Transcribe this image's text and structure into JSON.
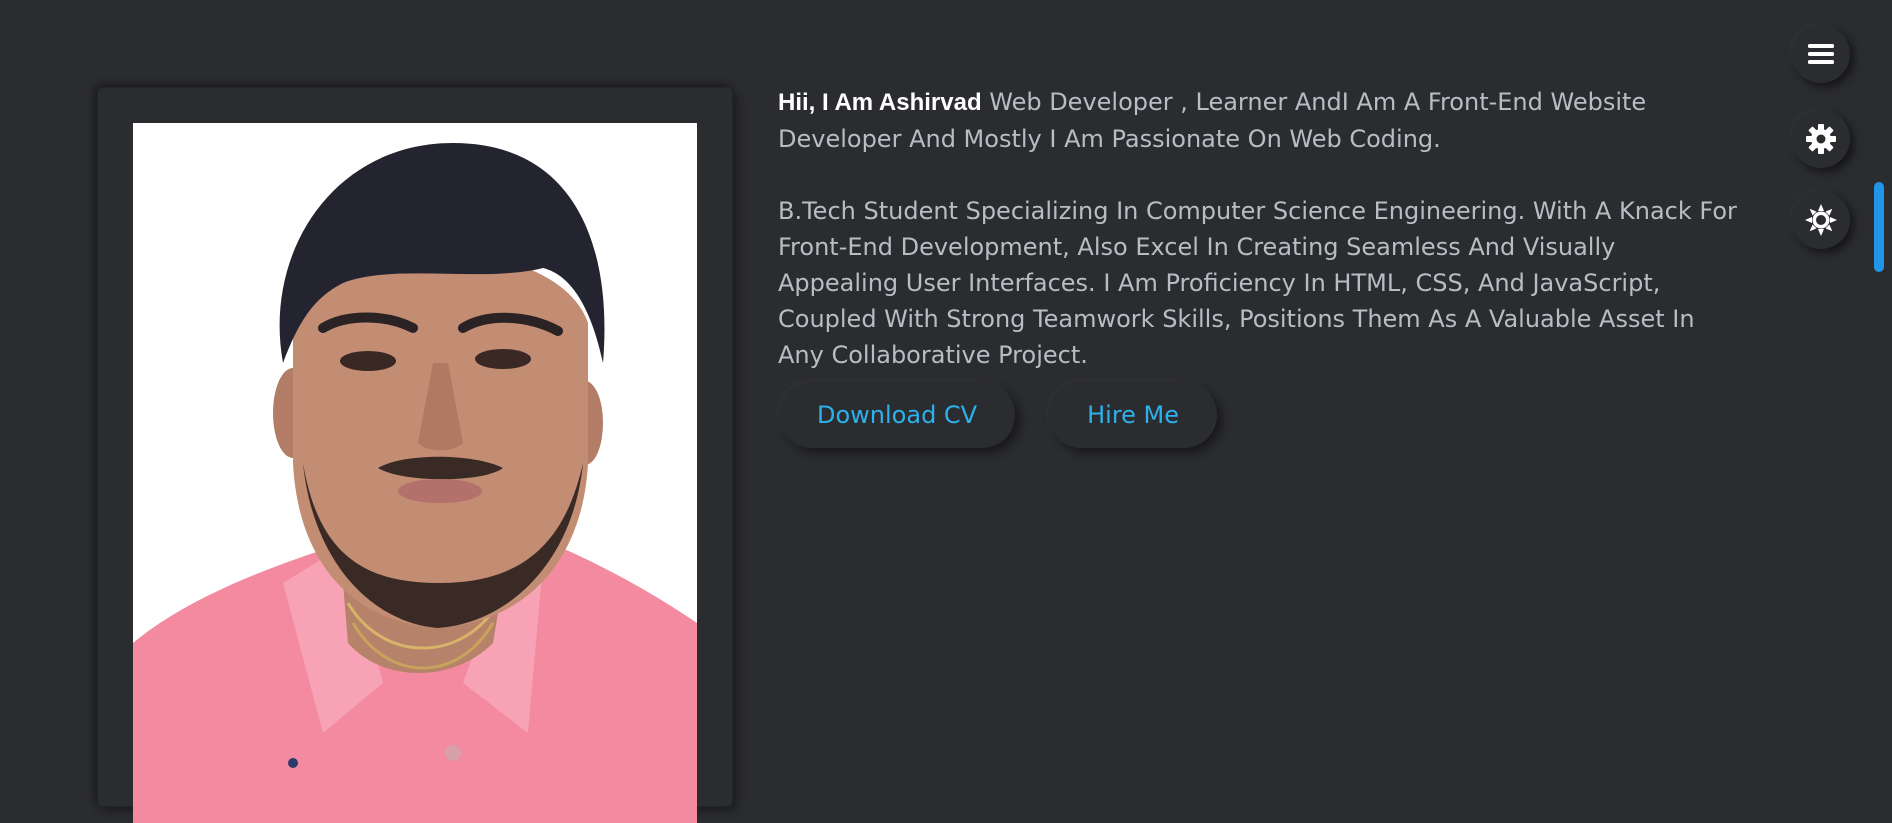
{
  "about": {
    "name": "Hii, I Am Ashirvad",
    "intro_rest": " Web Developer , Learner AndI Am A Front-End Website Developer And Mostly I Am Passionate On Web Coding.",
    "bio": "B.Tech Student Specializing In Computer Science Engineering. With A Knack For Front-End Development, Also Excel In Creating Seamless And Visually Appealing User Interfaces. I Am Proficiency In HTML, CSS, And JavaScript, Coupled With Strong Teamwork Skills, Positions Them As A Valuable Asset In Any Collaborative Project."
  },
  "buttons": {
    "download_cv": "Download CV",
    "hire_me": "Hire Me"
  },
  "side_controls": [
    {
      "icon": "hamburger-menu-icon"
    },
    {
      "icon": "gear-icon"
    },
    {
      "icon": "sun-icon"
    }
  ],
  "colors": {
    "background": "#2b2c30",
    "accent": "#2eb0ea",
    "text": "#b9bcc2",
    "heading": "#ffffff",
    "scrollbar": "#2196e9"
  }
}
